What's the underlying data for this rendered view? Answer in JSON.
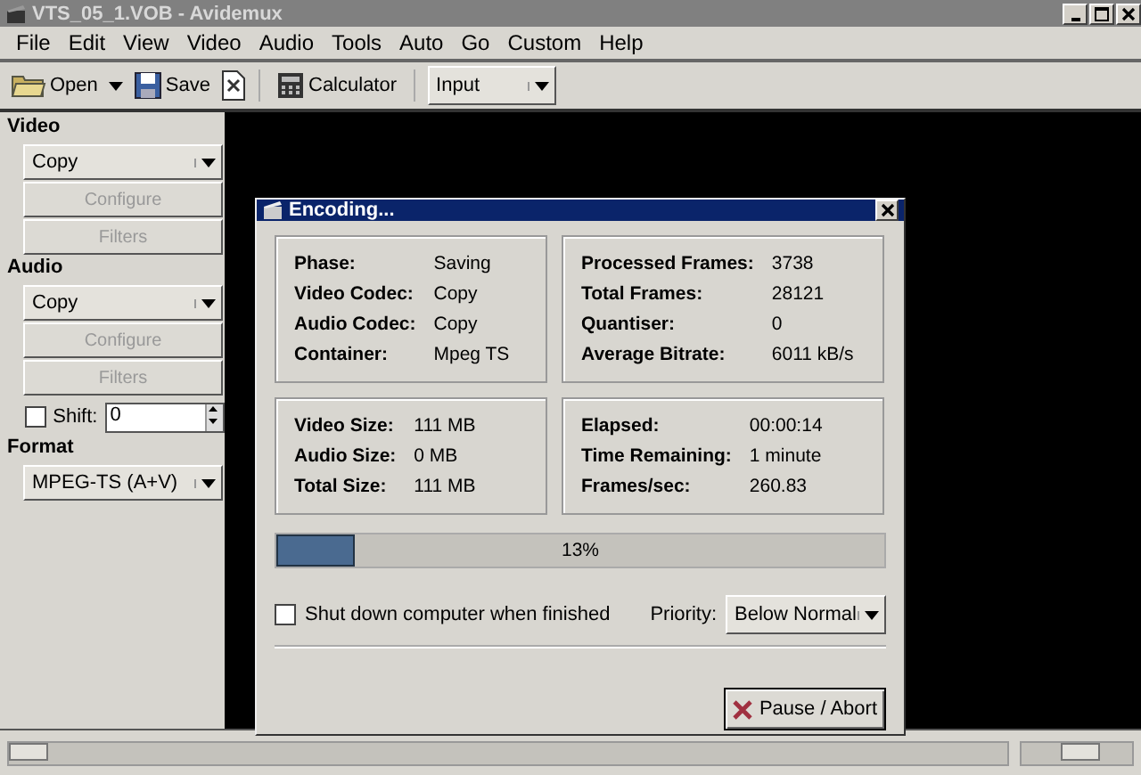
{
  "window": {
    "title": "VTS_05_1.VOB - Avidemux"
  },
  "menu": [
    "File",
    "Edit",
    "View",
    "Video",
    "Audio",
    "Tools",
    "Auto",
    "Go",
    "Custom",
    "Help"
  ],
  "toolbar": {
    "open": "Open",
    "save": "Save",
    "calculator": "Calculator",
    "view_select": "Input"
  },
  "sidebar": {
    "video": {
      "heading": "Video",
      "codec": "Copy",
      "configure": "Configure",
      "filters": "Filters"
    },
    "audio": {
      "heading": "Audio",
      "codec": "Copy",
      "configure": "Configure",
      "filters": "Filters",
      "shift_label": "Shift:",
      "shift_checked": false,
      "shift_value": "0"
    },
    "format": {
      "heading": "Format",
      "value": "MPEG-TS (A+V)"
    }
  },
  "dialog": {
    "title": "Encoding...",
    "groups": [
      [
        {
          "label": "Phase:",
          "value": "Saving"
        },
        {
          "label": "Video Codec:",
          "value": "Copy"
        },
        {
          "label": "Audio Codec:",
          "value": "Copy"
        },
        {
          "label": "Container:",
          "value": "Mpeg TS"
        }
      ],
      [
        {
          "label": "Processed Frames:",
          "value": "3738"
        },
        {
          "label": "Total Frames:",
          "value": "28121"
        },
        {
          "label": "Quantiser:",
          "value": "0"
        },
        {
          "label": "Average Bitrate:",
          "value": "6011 kB/s"
        }
      ],
      [
        {
          "label": "Video Size:",
          "value": "111 MB"
        },
        {
          "label": "Audio Size:",
          "value": "0 MB"
        },
        {
          "label": "Total Size:",
          "value": "111 MB"
        }
      ],
      [
        {
          "label": "Elapsed:",
          "value": "00:00:14"
        },
        {
          "label": "Time Remaining:",
          "value": "1 minute"
        },
        {
          "label": "Frames/sec:",
          "value": "260.83"
        }
      ]
    ],
    "progress": {
      "level": 0.13,
      "reading": "13%"
    },
    "shutdown": {
      "label": "Shut down computer when finished",
      "checked": false
    },
    "priority": {
      "label": "Priority:",
      "value": "Below Normal"
    },
    "button": "Pause / Abort"
  },
  "seek_slider": {
    "level": 0.0
  },
  "volume_slider": {
    "level": 0.55
  }
}
